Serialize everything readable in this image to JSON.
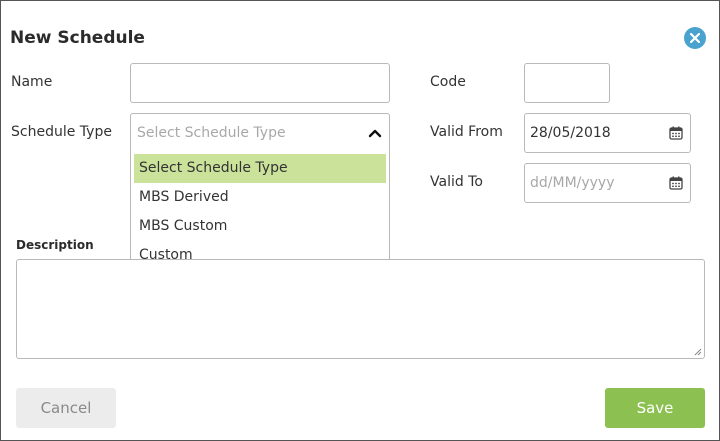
{
  "dialog": {
    "title": "New Schedule",
    "close_icon": "close-circle-icon"
  },
  "form": {
    "name": {
      "label": "Name",
      "value": ""
    },
    "code": {
      "label": "Code",
      "value": ""
    },
    "schedule_type": {
      "label": "Schedule Type",
      "placeholder": "Select Schedule Type",
      "expanded": true,
      "options": [
        {
          "label": "Select Schedule Type",
          "highlighted": true
        },
        {
          "label": "MBS Derived",
          "highlighted": false
        },
        {
          "label": "MBS Custom",
          "highlighted": false
        },
        {
          "label": "Custom",
          "highlighted": false
        }
      ]
    },
    "valid_from": {
      "label": "Valid From",
      "value": "28/05/2018",
      "icon": "calendar-icon"
    },
    "valid_to": {
      "label": "Valid To",
      "placeholder": "dd/MM/yyyy",
      "icon": "calendar-icon"
    },
    "description": {
      "label": "Description",
      "value": ""
    }
  },
  "buttons": {
    "cancel": "Cancel",
    "save": "Save"
  },
  "colors": {
    "accent_green": "#8cc152",
    "option_highlight": "#cbe29b",
    "close_blue": "#4aa3cf"
  }
}
